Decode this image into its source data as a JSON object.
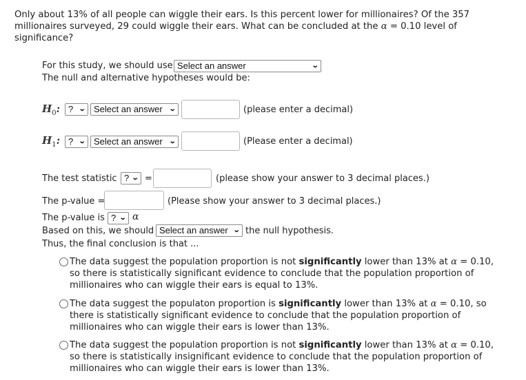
{
  "question": {
    "line1": "Only about 13% of all people can wiggle their ears. Is this percent lower for millionaires? Of the 357",
    "line2_a": "millionaires surveyed, 29 could wiggle their ears. What can be concluded at the",
    "alpha_symbol": "α",
    "line2_b": "= 0.10 level of",
    "line3": "significance?"
  },
  "study": {
    "label": "For this study, we should use",
    "select_value": "Select an answer",
    "hypotheses_label": "The null and alternative hypotheses would be:"
  },
  "h0": {
    "symbol": "H",
    "subscript": "0",
    "colon": ":",
    "operator_value": "?",
    "param_value": "Select an answer",
    "input_value": "",
    "hint": "(please enter a decimal)"
  },
  "h1": {
    "symbol": "H",
    "subscript": "1",
    "colon": ":",
    "operator_value": "?",
    "param_value": "Select an answer",
    "input_value": "",
    "hint": "(Please enter a decimal)"
  },
  "test_statistic": {
    "label": "The test statistic",
    "select_value": "?",
    "equals": "=",
    "input_value": "",
    "hint": "(please show your answer to 3 decimal places.)"
  },
  "p_value": {
    "label": "The p-value =",
    "input_value": "",
    "hint": "(Please show your answer to 3 decimal places.)"
  },
  "p_value_compare": {
    "label": "The p-value is",
    "select_value": "?",
    "alpha_symbol": "α"
  },
  "decision": {
    "label": "Based on this, we should",
    "select_value": "Select an answer",
    "suffix": "the null hypothesis."
  },
  "conclusion": {
    "label": "Thus, the final conclusion is that ...",
    "options": [
      {
        "pre": "The data suggest the population proportion is not ",
        "bold": "significantly",
        "mid": " lower than 13% at ",
        "alpha": "α",
        "post": " = 0.10, so there is statistically significant evidence to conclude that the population proportion of millionaires who can wiggle their ears is equal to 13%.",
        "selected": false
      },
      {
        "pre": "The data suggest the populaton proportion is ",
        "bold": "significantly",
        "mid": " lower than 13% at ",
        "alpha": "α",
        "post": " = 0.10, so there is statistically significant evidence to conclude that the population proportion of millionaires who can wiggle their ears is lower than 13%.",
        "selected": false
      },
      {
        "pre": "The data suggest the population proportion is not ",
        "bold": "significantly",
        "mid": " lower than 13% at ",
        "alpha": "α",
        "post": " = 0.10, so there is statistically insignificant evidence to conclude that the population proportion of millionaires who can wiggle their ears is lower than 13%.",
        "selected": false
      }
    ]
  }
}
